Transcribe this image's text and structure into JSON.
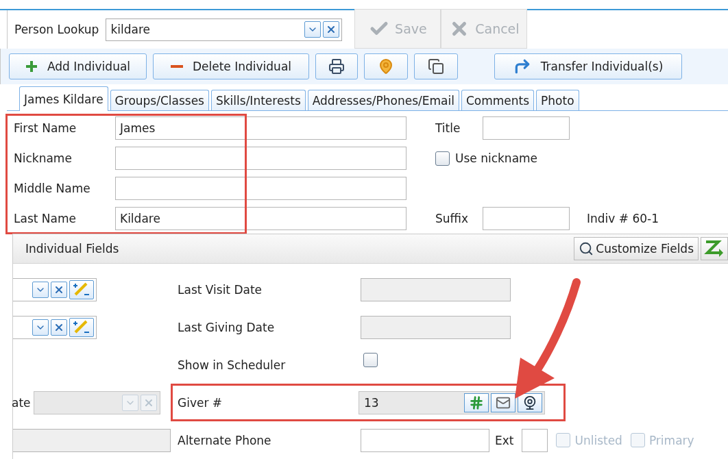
{
  "lookup": {
    "label": "Person Lookup",
    "value": "kildare"
  },
  "actions": [
    {
      "kind": "save",
      "label": "Save",
      "disabled": true
    },
    {
      "kind": "cancel",
      "label": "Cancel",
      "disabled": true
    }
  ],
  "toolbar": [
    {
      "kind": "add",
      "label": "Add Individual"
    },
    {
      "kind": "delete",
      "label": "Delete Individual"
    },
    {
      "kind": "print"
    },
    {
      "kind": "map"
    },
    {
      "kind": "copy"
    },
    {
      "kind": "transfer",
      "label": "Transfer Individual(s)"
    }
  ],
  "tabs": [
    {
      "label": "James Kildare",
      "selected": true
    },
    {
      "label": "Groups/Classes",
      "selected": false
    },
    {
      "label": "Skills/Interests",
      "selected": false
    },
    {
      "label": "Addresses/Phones/Email",
      "selected": false
    },
    {
      "label": "Comments",
      "selected": false
    },
    {
      "label": "Photo",
      "selected": false
    }
  ],
  "name_section": {
    "highlighted": true,
    "fields": [
      {
        "label": "First Name",
        "value": "James"
      },
      {
        "label": "Nickname"
      },
      {
        "label": "Middle Name"
      },
      {
        "label": "Last Name",
        "value": "Kildare"
      }
    ]
  },
  "title": {
    "label": "Title"
  },
  "use_nickname": {
    "label": "Use nickname",
    "checked": false
  },
  "suffix": {
    "label": "Suffix"
  },
  "indiv_number": "Indiv # 60-1",
  "panel": {
    "title": "Individual Fields",
    "customize": "Customize Fields",
    "left_rows": [
      {
        "kind": "combo"
      },
      {
        "kind": "combo"
      },
      {
        "kind": "empty"
      },
      {
        "kind": "disabled_combo",
        "label": "ate"
      },
      {
        "kind": "disabled_input"
      }
    ],
    "right_rows": [
      {
        "kind": "disabled_input",
        "label": "Last Visit Date"
      },
      {
        "kind": "disabled_input",
        "label": "Last Giving Date"
      },
      {
        "kind": "checkbox",
        "label": "Show in Scheduler",
        "checked": false
      },
      {
        "kind": "giver",
        "label": "Giver #",
        "value": "13",
        "highlighted": true
      },
      {
        "kind": "phone",
        "label": "Alternate Phone",
        "ext": "Ext",
        "options": [
          {
            "label": "Unlisted",
            "checked": false,
            "disabled": true
          },
          {
            "label": "Primary",
            "checked": false,
            "disabled": true
          }
        ]
      }
    ],
    "arrow": true
  }
}
